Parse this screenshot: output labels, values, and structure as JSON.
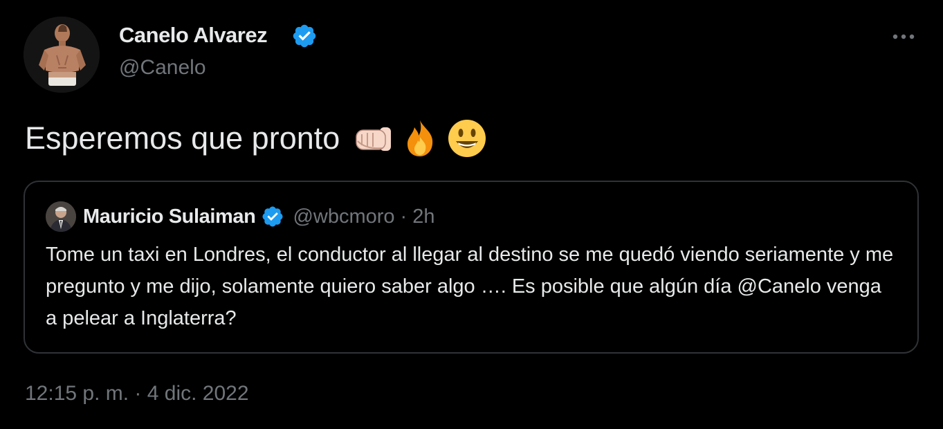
{
  "tweet": {
    "author": {
      "name": "Canelo Alvarez",
      "handle": "@Canelo",
      "verified": true
    },
    "text": "Esperemos que pronto",
    "emojis": [
      "fist-icon",
      "fire-icon",
      "smiley-icon"
    ],
    "timestamp": "12:15 p. m. · 4 dic. 2022"
  },
  "quote": {
    "author": {
      "name": "Mauricio Sulaiman",
      "handle": "@wbcmoro",
      "verified": true
    },
    "separator": "·",
    "time": "2h",
    "text": "Tome un taxi en Londres, el conductor al llegar al destino se me quedó viendo seriamente y me pregunto y me dijo, solamente quiero saber algo …. Es posible que algún día @Canelo venga a pelear a Inglaterra?"
  },
  "colors": {
    "background": "#000000",
    "text_primary": "#e7e9ea",
    "text_secondary": "#71767b",
    "verified_blue": "#1d9bf0",
    "border": "#2f3336"
  },
  "icons": {
    "more": "more-horizontal-icon",
    "verified": "verified-badge-icon"
  }
}
